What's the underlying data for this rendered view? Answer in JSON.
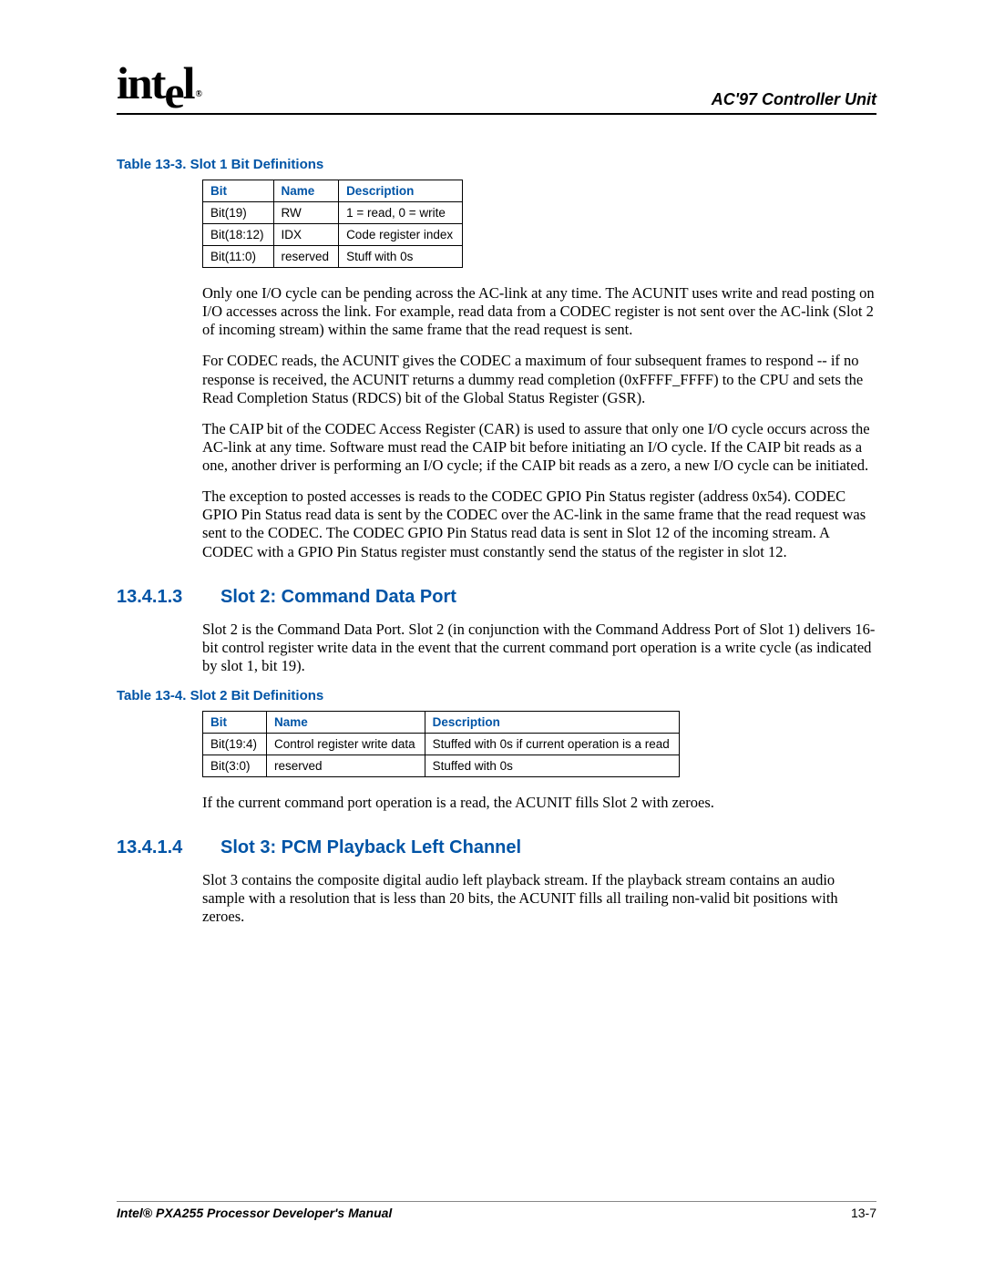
{
  "header": {
    "logo_text": "intel",
    "doc_section": "AC'97 Controller Unit"
  },
  "table1": {
    "caption": "Table 13-3. Slot 1 Bit Definitions",
    "headers": {
      "c0": "Bit",
      "c1": "Name",
      "c2": "Description"
    },
    "rows": [
      {
        "c0": "Bit(19)",
        "c1": "RW",
        "c2": "1 = read, 0 = write"
      },
      {
        "c0": "Bit(18:12)",
        "c1": "IDX",
        "c2": "Code register index"
      },
      {
        "c0": "Bit(11:0)",
        "c1": "reserved",
        "c2": "Stuff with 0s"
      }
    ]
  },
  "paragraphs_a": {
    "p1": "Only one I/O cycle can be pending across the AC-link at any time. The ACUNIT uses write and read posting on I/O accesses across the link. For example, read data from a CODEC register is not sent over the AC-link (Slot 2 of incoming stream) within the same frame that the read request is sent.",
    "p2": "For CODEC reads, the ACUNIT gives the CODEC a maximum of four subsequent frames to respond -- if no response is received, the ACUNIT returns a dummy read completion (0xFFFF_FFFF) to the CPU and sets the Read Completion Status (RDCS) bit of the Global Status Register (GSR).",
    "p3": "The CAIP bit of the CODEC Access Register (CAR) is used to assure that only one I/O cycle occurs across the AC-link at any time. Software must read the CAIP bit before initiating an I/O cycle. If the CAIP bit reads as a one, another driver is performing an I/O cycle; if the CAIP bit reads as a zero, a new I/O cycle can be initiated.",
    "p4": "The exception to posted accesses is reads to the CODEC GPIO Pin Status register (address 0x54). CODEC GPIO Pin Status read data is sent by the CODEC over the AC-link in the same frame that the read request was sent to the CODEC. The CODEC GPIO Pin Status read data is sent in Slot 12 of the incoming stream. A CODEC with a GPIO Pin Status register must constantly send the status of the register in slot 12."
  },
  "heading1": {
    "num": "13.4.1.3",
    "title": "Slot 2: Command Data Port"
  },
  "paragraphs_b": {
    "p1": "Slot 2 is the Command Data Port. Slot 2 (in conjunction with the Command Address Port of Slot 1) delivers 16-bit control register write data in the event that the current command port operation is a write cycle (as indicated by slot 1, bit 19)."
  },
  "table2": {
    "caption": "Table 13-4. Slot 2 Bit Definitions",
    "headers": {
      "c0": "Bit",
      "c1": "Name",
      "c2": "Description"
    },
    "rows": [
      {
        "c0": "Bit(19:4)",
        "c1": "Control register write data",
        "c2": "Stuffed with 0s if current operation is a read"
      },
      {
        "c0": "Bit(3:0)",
        "c1": "reserved",
        "c2": "Stuffed with 0s"
      }
    ]
  },
  "paragraphs_c": {
    "p1": "If the current command port operation is a read, the ACUNIT fills Slot 2 with zeroes."
  },
  "heading2": {
    "num": "13.4.1.4",
    "title": "Slot 3: PCM Playback Left Channel"
  },
  "paragraphs_d": {
    "p1": "Slot 3 contains the composite digital audio left playback stream. If the playback stream contains an audio sample with a resolution that is less than 20 bits, the ACUNIT fills all trailing non-valid bit positions with zeroes."
  },
  "footer": {
    "left": "Intel® PXA255 Processor Developer's Manual",
    "right": "13-7"
  }
}
